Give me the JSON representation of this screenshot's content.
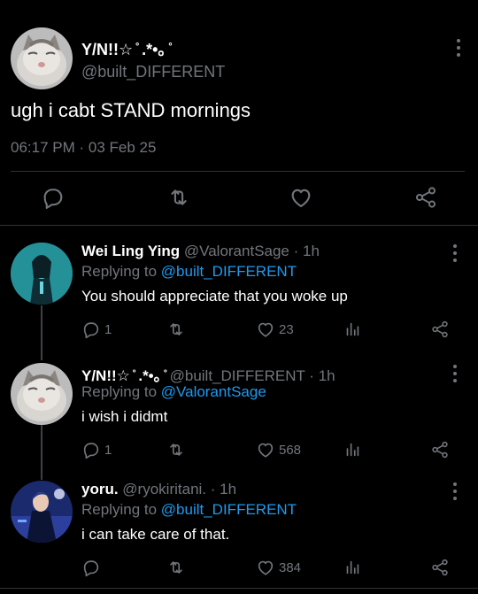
{
  "main_tweet": {
    "display_name": "Y/N!!☆ ̊ .*•｡ ̊",
    "handle": "@built_DIFFERENT",
    "text": "ugh i cabt STAND mornings",
    "timestamp": "06:17 PM · 03 Feb 25",
    "avatar_icon": "cat-avatar",
    "actions": [
      "reply-icon",
      "retweet-icon",
      "like-icon",
      "share-icon"
    ]
  },
  "replies": [
    {
      "display_name": "Wei Ling Ying",
      "meta": "@ValorantSage · 1h",
      "replying_prefix": "Replying to ",
      "replying_to": "@built_DIFFERENT",
      "text": "You should appreciate that you woke up",
      "reply_count": "1",
      "retweet_count": "",
      "like_count": "23",
      "avatar_icon": "character-avatar"
    },
    {
      "display_name": "Y/N!!☆ ̊ .*•｡ ̊",
      "meta": "@built_DIFFERENT · 1h",
      "replying_prefix": "Replying to ",
      "replying_to": "@ValorantSage",
      "text": "i wish i didmt",
      "reply_count": "1",
      "retweet_count": "",
      "like_count": "568",
      "avatar_icon": "cat-avatar"
    },
    {
      "display_name": "yoru.",
      "meta": "@ryokiritani. · 1h",
      "replying_prefix": "Replying to ",
      "replying_to": "@built_DIFFERENT",
      "text": "i can take care of that.",
      "reply_count": "",
      "retweet_count": "",
      "like_count": "384",
      "avatar_icon": "character-avatar-blue"
    }
  ],
  "colors": {
    "background": "#000000",
    "text": "#e7e9ea",
    "muted": "#71767b",
    "link": "#1d9bf0",
    "divider": "#2f3336"
  }
}
